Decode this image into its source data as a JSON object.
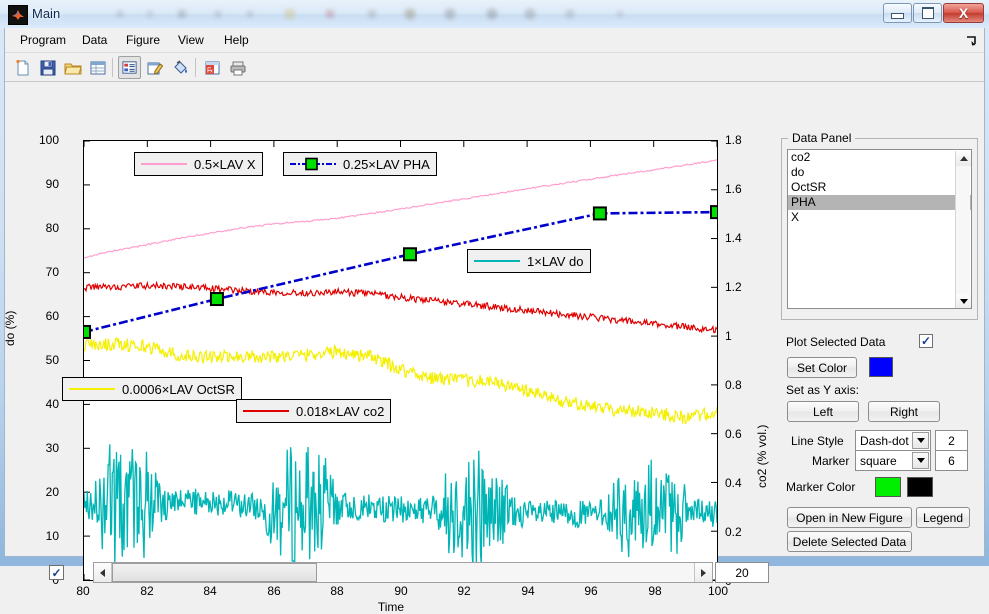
{
  "window": {
    "title": "Main",
    "icon": "matlab-icon",
    "minimize_label": "Minimize",
    "maximize_label": "Maximize",
    "close_label": "X"
  },
  "menubar": {
    "items": [
      {
        "label": "Program",
        "name": "menu-program"
      },
      {
        "label": "Data",
        "name": "menu-data"
      },
      {
        "label": "Figure",
        "name": "menu-figure"
      },
      {
        "label": "View",
        "name": "menu-view"
      },
      {
        "label": "Help",
        "name": "menu-help"
      }
    ],
    "overflow_icon": "overflow-arrow-icon"
  },
  "toolbar": {
    "buttons": [
      {
        "name": "new-file-icon",
        "title": "New"
      },
      {
        "name": "save-icon",
        "title": "Save"
      },
      {
        "name": "open-folder-icon",
        "title": "Open"
      },
      {
        "name": "table-view-icon",
        "title": "Data table"
      },
      {
        "name": "properties-list-icon",
        "title": "Properties",
        "selected": true
      },
      {
        "name": "edit-plot-icon",
        "title": "Edit plot"
      },
      {
        "name": "fill-color-icon",
        "title": "Fill color"
      },
      {
        "name": "export-excel-icon",
        "title": "Export"
      },
      {
        "name": "print-icon",
        "title": "Print"
      }
    ]
  },
  "chart_data": {
    "type": "line",
    "title": "",
    "xlabel": "Time",
    "ylabel_left": "do (%)",
    "ylabel_right": "co2 (% vol.)",
    "xlim": [
      80,
      100
    ],
    "xticks": [
      80,
      82,
      84,
      86,
      88,
      90,
      92,
      94,
      96,
      98,
      100
    ],
    "ylim_left": [
      0,
      100
    ],
    "yticks_left": [
      0,
      10,
      20,
      30,
      40,
      50,
      60,
      70,
      80,
      90,
      100
    ],
    "ylim_right": [
      0,
      1.8
    ],
    "yticks_right": [
      "0",
      "0.2",
      "0.4",
      "0.6",
      "0.8",
      "1",
      "1.2",
      "1.4",
      "1.6",
      "1.8"
    ],
    "grid": false,
    "legend_position": "in-plot-boxes",
    "series": [
      {
        "name": "X",
        "legend": "0.5×LAV X",
        "color": "#ff9fcf",
        "axis": "left",
        "style": "solid",
        "width": 1,
        "marker": "none",
        "x": [
          80,
          81,
          82,
          83,
          84,
          85,
          86,
          87,
          88,
          89,
          90,
          91,
          92,
          93,
          94,
          95,
          96,
          97,
          98,
          99,
          100
        ],
        "y": [
          73.5,
          75.0,
          76.4,
          77.8,
          79.0,
          80.2,
          81.1,
          81.7,
          82.4,
          83.4,
          84.5,
          85.7,
          86.8,
          88.0,
          89.1,
          90.2,
          91.3,
          92.4,
          93.4,
          94.5,
          95.6
        ]
      },
      {
        "name": "co2",
        "legend": "0.018×LAV co2",
        "color": "#e00000",
        "axis": "left",
        "style": "solid",
        "width": 1,
        "marker": "none",
        "x": [
          80,
          81,
          82,
          83,
          84,
          85,
          86,
          87,
          88,
          89,
          90,
          91,
          92,
          93,
          94,
          95,
          96,
          97,
          98,
          99,
          100
        ],
        "y": [
          66.6,
          66.8,
          67.0,
          66.9,
          66.4,
          65.9,
          65.6,
          65.4,
          65.6,
          65.3,
          64.4,
          63.6,
          62.9,
          62.2,
          61.4,
          60.6,
          59.9,
          59.1,
          58.3,
          57.7,
          56.9
        ]
      },
      {
        "name": "OctSR",
        "legend": "0.0006×LAV OctSR",
        "color": "#f5f000",
        "axis": "left",
        "style": "solid",
        "width": 1,
        "marker": "none",
        "x": [
          80,
          81,
          82,
          83,
          84,
          85,
          86,
          87,
          88,
          89,
          90,
          91,
          92,
          93,
          94,
          95,
          96,
          97,
          98,
          99,
          100
        ],
        "y": [
          53.4,
          53.8,
          53.2,
          51.2,
          50.7,
          51.0,
          50.9,
          51.3,
          52.0,
          51.0,
          48.0,
          46.0,
          45.5,
          45.0,
          43.0,
          41.0,
          39.5,
          38.6,
          38.2,
          37.0,
          38.0
        ]
      },
      {
        "name": "do",
        "legend": "1×LAV do",
        "color": "#00b5b5",
        "axis": "left",
        "style": "solid",
        "width": 1,
        "marker": "none",
        "x": [
          80,
          82,
          84,
          86,
          88,
          90,
          92,
          94,
          96,
          98,
          100
        ],
        "y": [
          18,
          17,
          18,
          16,
          17,
          16,
          16,
          15,
          15,
          16,
          15
        ],
        "noise_amplitude": 8,
        "note": "high-frequency oscillating signal, range roughly 5-28%"
      },
      {
        "name": "PHA",
        "legend": "0.25×LAV PHA",
        "color": "#0000cc",
        "axis": "right",
        "style": "dash-dot",
        "width": 2,
        "marker": "square",
        "marker_color": "#00e000",
        "marker_edge": "#000000",
        "marker_size": 6,
        "x": [
          80,
          84.2,
          90.3,
          96.3,
          100
        ],
        "y_left_equiv": [
          56.5,
          64.0,
          74.2,
          83.5,
          83.8
        ],
        "y_right": [
          1.017,
          1.152,
          1.336,
          1.503,
          1.508
        ]
      }
    ],
    "legend_boxes": [
      {
        "label": "0.5×LAV X",
        "color": "#ff9fcf",
        "style": "solid",
        "marker": "none"
      },
      {
        "label": "0.25×LAV PHA",
        "color": "#0000cc",
        "style": "dash-dot",
        "marker": "square"
      },
      {
        "label": "1×LAV do",
        "color": "#00b5b5",
        "style": "solid",
        "marker": "none"
      },
      {
        "label": "0.0006×LAV OctSR",
        "color": "#f5f000",
        "style": "solid",
        "marker": "none"
      },
      {
        "label": "0.018×LAV co2",
        "color": "#e00000",
        "style": "solid",
        "marker": "none"
      }
    ]
  },
  "bottom": {
    "checkbox_checked": true,
    "scroll_value": "20",
    "left_arrow": "scroll-left-icon",
    "right_arrow": "scroll-right-icon"
  },
  "data_panel": {
    "group_title": "Data Panel",
    "items": [
      {
        "label": "co2",
        "selected": false
      },
      {
        "label": "do",
        "selected": false
      },
      {
        "label": "OctSR",
        "selected": false
      },
      {
        "label": "PHA",
        "selected": true
      },
      {
        "label": "X",
        "selected": false
      }
    ],
    "plot_selected_label": "Plot Selected Data",
    "plot_selected_checked": true,
    "set_color_label": "Set Color",
    "set_color_value": "#0000ff",
    "set_y_axis_label": "Set as Y axis:",
    "left_label": "Left",
    "right_label": "Right",
    "line_style_label": "Line Style",
    "line_style_value": "Dash-dot",
    "line_width_value": "2",
    "marker_label": "Marker",
    "marker_value": "square",
    "marker_size_value": "6",
    "marker_color_label": "Marker Color",
    "marker_fill_color": "#00ee00",
    "marker_edge_color": "#000000",
    "open_in_new_figure_label": "Open in New Figure",
    "legend_label": "Legend",
    "delete_selected_label": "Delete Selected Data"
  }
}
